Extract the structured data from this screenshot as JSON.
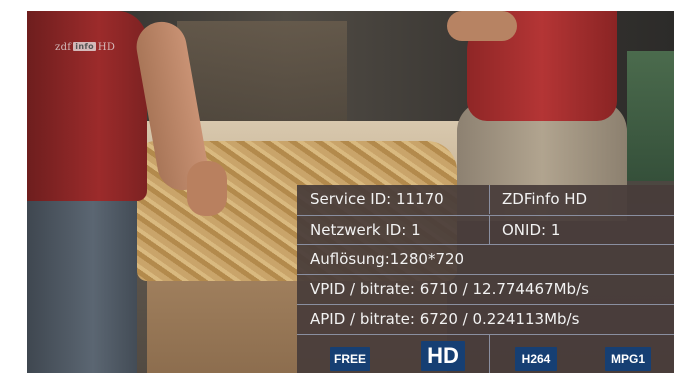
{
  "channel_logo": {
    "prefix": "zdf",
    "box": "info",
    "suffix": "HD"
  },
  "info_panel": {
    "service_id": "Service ID: 11170",
    "channel_name": "ZDFinfo HD",
    "network_id": "Netzwerk ID: 1",
    "onid": "ONID: 1",
    "resolution": "Auflösung:1280*720",
    "video_pid": "VPID / bitrate: 6710 / 12.774467Mb/s",
    "audio_pid": "APID / bitrate: 6720 / 0.224113Mb/s",
    "badges": {
      "free": "FREE",
      "hd": "HD",
      "video_codec": "H264",
      "audio_codec": "MPG1"
    }
  },
  "colors": {
    "panel_background": "#483c3a",
    "grid_lines": "#8a8fa0",
    "badge_background": "#163f73",
    "text": "#f2f2f2"
  }
}
